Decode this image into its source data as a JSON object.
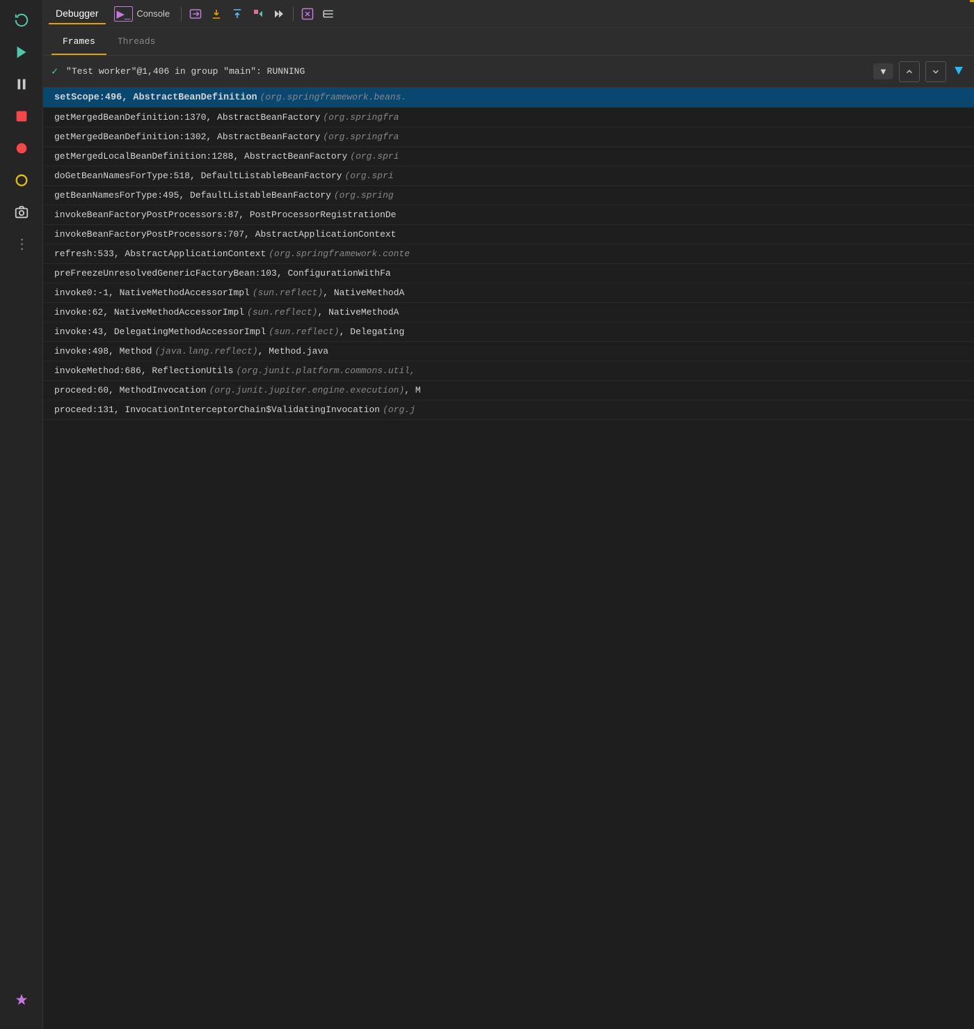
{
  "toolbar": {
    "debugger_label": "Debugger",
    "console_label": "Console",
    "buttons": [
      {
        "icon": "⟳",
        "name": "restart",
        "tooltip": "Restart"
      },
      {
        "icon": "▶",
        "name": "resume",
        "tooltip": "Resume"
      },
      {
        "icon": "⏸",
        "name": "pause",
        "tooltip": "Pause"
      },
      {
        "icon": "⏹",
        "name": "stop",
        "tooltip": "Stop"
      },
      {
        "icon": "●",
        "name": "breakpoint",
        "tooltip": "Breakpoint"
      },
      {
        "icon": "◎",
        "name": "mute",
        "tooltip": "Mute"
      },
      {
        "icon": "📷",
        "name": "snapshot",
        "tooltip": "Snapshot"
      },
      {
        "icon": "⋮",
        "name": "more",
        "tooltip": "More"
      }
    ]
  },
  "tabs": {
    "frames_label": "Frames",
    "threads_label": "Threads",
    "active": "frames"
  },
  "thread_selector": {
    "check_symbol": "✓",
    "label": "\"Test worker\"@1,406 in group \"main\": RUNNING",
    "dropdown_arrow": "▼",
    "up_arrow": "↑",
    "down_arrow": "↓",
    "filter_icon": "▼"
  },
  "frames": [
    {
      "method": "setScope:496, AbstractBeanDefinition",
      "package": "(org.springframework.beans.",
      "selected": true
    },
    {
      "method": "getMergedBeanDefinition:1370, AbstractBeanFactory",
      "package": "(org.springfra",
      "selected": false
    },
    {
      "method": "getMergedBeanDefinition:1302, AbstractBeanFactory",
      "package": "(org.springfra",
      "selected": false
    },
    {
      "method": "getMergedLocalBeanDefinition:1288, AbstractBeanFactory",
      "package": "(org.spri",
      "selected": false
    },
    {
      "method": "doGetBeanNamesForType:518, DefaultListableBeanFactory",
      "package": "(org.spri",
      "selected": false
    },
    {
      "method": "getBeanNamesForType:495, DefaultListableBeanFactory",
      "package": "(org.spring",
      "selected": false
    },
    {
      "method": "invokeBeanFactoryPostProcessors:87, PostProcessorRegistrationDe",
      "package": "",
      "selected": false
    },
    {
      "method": "invokeBeanFactoryPostProcessors:707, AbstractApplicationContext",
      "package": "",
      "selected": false
    },
    {
      "method": "refresh:533, AbstractApplicationContext",
      "package": "(org.springframework.conte",
      "selected": false
    },
    {
      "method": "preFreezeUnresolvedGenericFactoryBean:103, ConfigurationWithFa",
      "package": "",
      "selected": false
    },
    {
      "method": "invoke0:-1, NativeMethodAccessorImpl",
      "package": "(sun.reflect)",
      "selected": false,
      "suffix": ", NativeMethodA"
    },
    {
      "method": "invoke:62, NativeMethodAccessorImpl",
      "package": "(sun.reflect)",
      "selected": false,
      "suffix": ", NativeMethodA"
    },
    {
      "method": "invoke:43, DelegatingMethodAccessorImpl",
      "package": "(sun.reflect)",
      "selected": false,
      "suffix": ", Delegating"
    },
    {
      "method": "invoke:498, Method",
      "package": "(java.lang.reflect)",
      "selected": false,
      "suffix": ", Method.java"
    },
    {
      "method": "invokeMethod:686, ReflectionUtils",
      "package": "(org.junit.platform.commons.util,",
      "selected": false
    },
    {
      "method": "proceed:60, MethodInvocation",
      "package": "(org.junit.jupiter.engine.execution)",
      "selected": false,
      "suffix": ", M"
    },
    {
      "method": "proceed:131, InvocationInterceptorChain$ValidatingInvocation",
      "package": "(org.j",
      "selected": false
    }
  ]
}
